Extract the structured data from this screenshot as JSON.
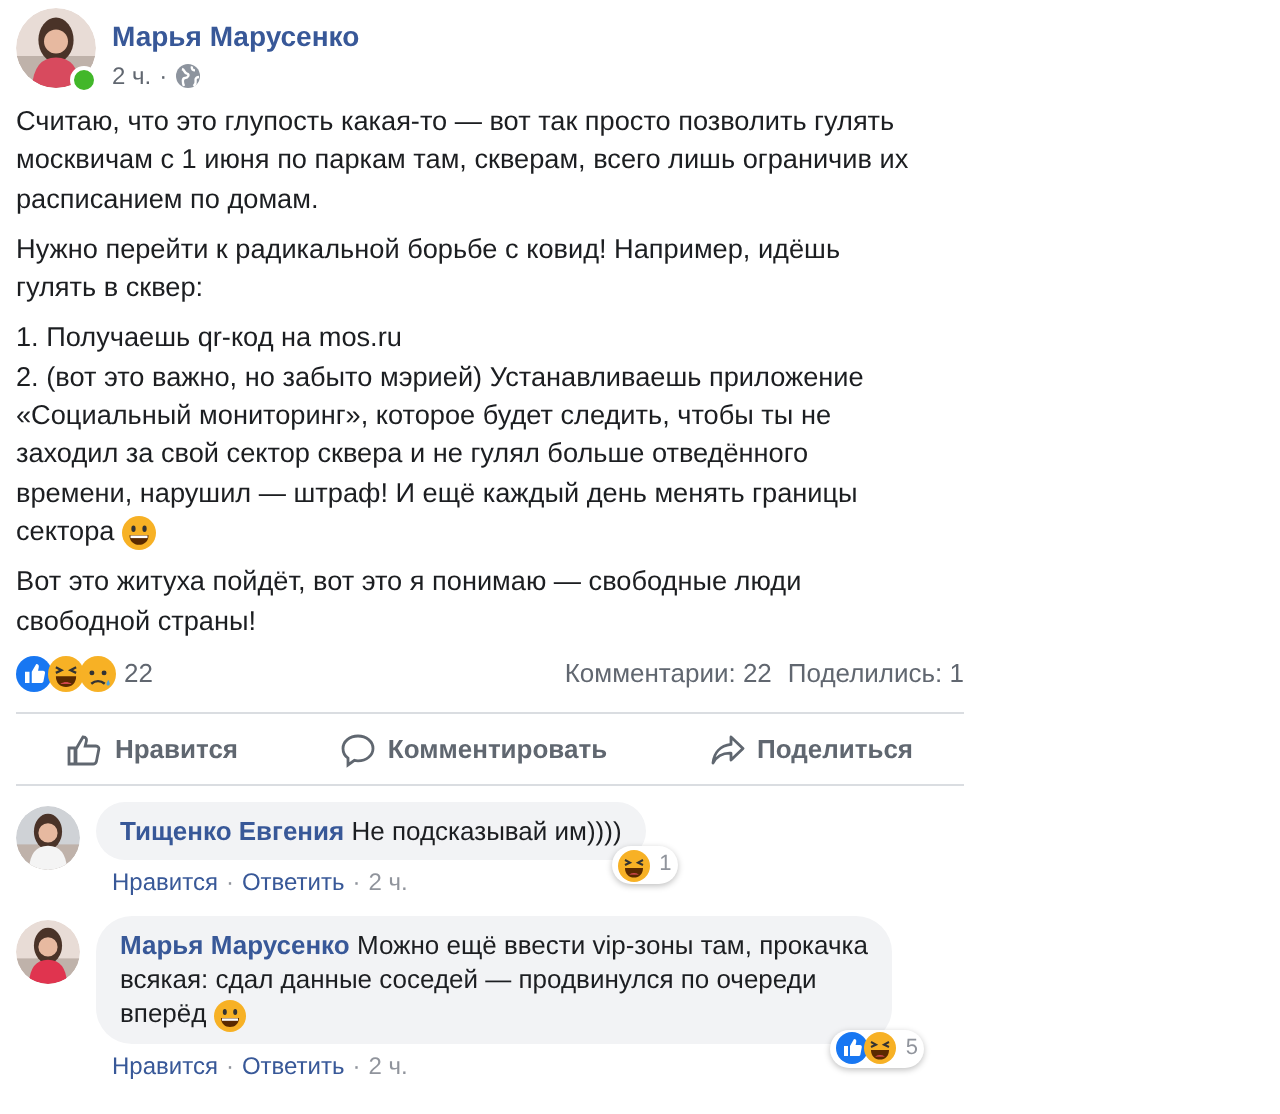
{
  "post": {
    "author": "Марья Марусенко",
    "online": true,
    "time": "2 ч.",
    "separator": "·",
    "paragraphs": [
      {
        "lines": [
          "Считаю, что это глупость какая-то — вот так просто позволить гулять",
          "москвичам с 1 июня по паркам там, скверам, всего лишь ограничив их",
          "расписанием по домам."
        ]
      },
      {
        "lines": [
          "Нужно перейти к радикальной борьбе с ковид! Например, идёшь",
          "гулять в сквер:"
        ]
      },
      {
        "lines": [
          "1. Получаешь qr-код на mos.ru",
          "2. (вот это важно, но забыто мэрией) Устанавливаешь приложение",
          "«Социальный мониторинг», которое будет следить, чтобы ты не",
          "заходил за свой сектор сквера и не гулял больше отведённого",
          "времени, нарушил — штраф! И ещё каждый день менять границы",
          "сектора"
        ],
        "emoji": {
          "kind": "grin"
        }
      },
      {
        "lines": [
          "Вот это житуха пойдёт, вот это я понимаю — свободные люди",
          "свободной страны!"
        ]
      }
    ],
    "reactions": [
      {
        "kind": "like"
      },
      {
        "kind": "haha"
      },
      {
        "kind": "sad"
      }
    ],
    "reaction_count": "22",
    "comments_count": "Комментарии: 22",
    "shares_count": "Поделились: 1",
    "actions": [
      {
        "kind": "like",
        "label": "Нравится"
      },
      {
        "kind": "comment",
        "label": "Комментировать"
      },
      {
        "kind": "share",
        "label": "Поделиться"
      }
    ]
  },
  "comments": [
    {
      "author": "Тищенко Евгения",
      "lines": [
        "Не подсказывай им))))"
      ],
      "reactions": [
        {
          "kind": "haha"
        }
      ],
      "reaction_count": "1",
      "like": "Нравится",
      "separator": "·",
      "reply": "Ответить",
      "time": "2 ч."
    },
    {
      "author": "Марья Марусенко",
      "lines": [
        "Можно ещё ввести vip-зоны там, прокачка",
        "всякая: сдал данные соседей — продвинулся по очереди",
        "вперёд"
      ],
      "emoji": {
        "kind": "grin"
      },
      "reactions": [
        {
          "kind": "like"
        },
        {
          "kind": "haha"
        }
      ],
      "reaction_count": "5",
      "like": "Нравится",
      "separator": "·",
      "reply": "Ответить",
      "time": "2 ч."
    }
  ]
}
